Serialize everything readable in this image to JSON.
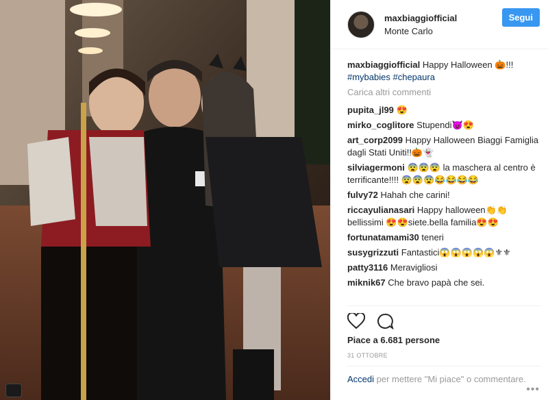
{
  "header": {
    "username": "maxbiaggiofficial",
    "location": "Monte Carlo",
    "follow_label": "Segui"
  },
  "caption": {
    "user": "maxbiaggiofficial",
    "text": "Happy Halloween 🎃!!!",
    "tags": "#mybabies #chepaura"
  },
  "load_more": "Carica altri commenti",
  "comments": [
    {
      "user": "pupita_jl99",
      "text": "😍"
    },
    {
      "user": "mirko_coglitore",
      "text": "Stupendi😈😍"
    },
    {
      "user": "art_corp2099",
      "text": "Happy Halloween Biaggi Famiglia dagli Stati Uniti!!🎃👻"
    },
    {
      "user": "silviagermoni",
      "text": "😨😨😨 la maschera al centro è terrificante!!!! 😨😨😨😂😂😂😂"
    },
    {
      "user": "fulvy72",
      "text": "Hahah che carini!"
    },
    {
      "user": "riccayulianasari",
      "text": "Happy halloween👏👏 bellissimi 😍😍siete.bella familia😍😍"
    },
    {
      "user": "fortunatamami30",
      "text": "teneri"
    },
    {
      "user": "susygrizzuti",
      "text": "Fantastici😱😱😱😱😱⚜⚜"
    },
    {
      "user": "patty3116",
      "text": "Meravigliosi"
    },
    {
      "user": "miknik67",
      "text": "Che bravo papà che sei."
    }
  ],
  "actions": {
    "like_icon": "heart-icon",
    "comment_icon": "comment-icon"
  },
  "likes": "Piace a 6.681 persone",
  "date": "31 OTTOBRE",
  "footer": {
    "login_link": "Accedi",
    "text": "per mettere \"Mi piace\" o commentare."
  },
  "more_dots": "•••"
}
